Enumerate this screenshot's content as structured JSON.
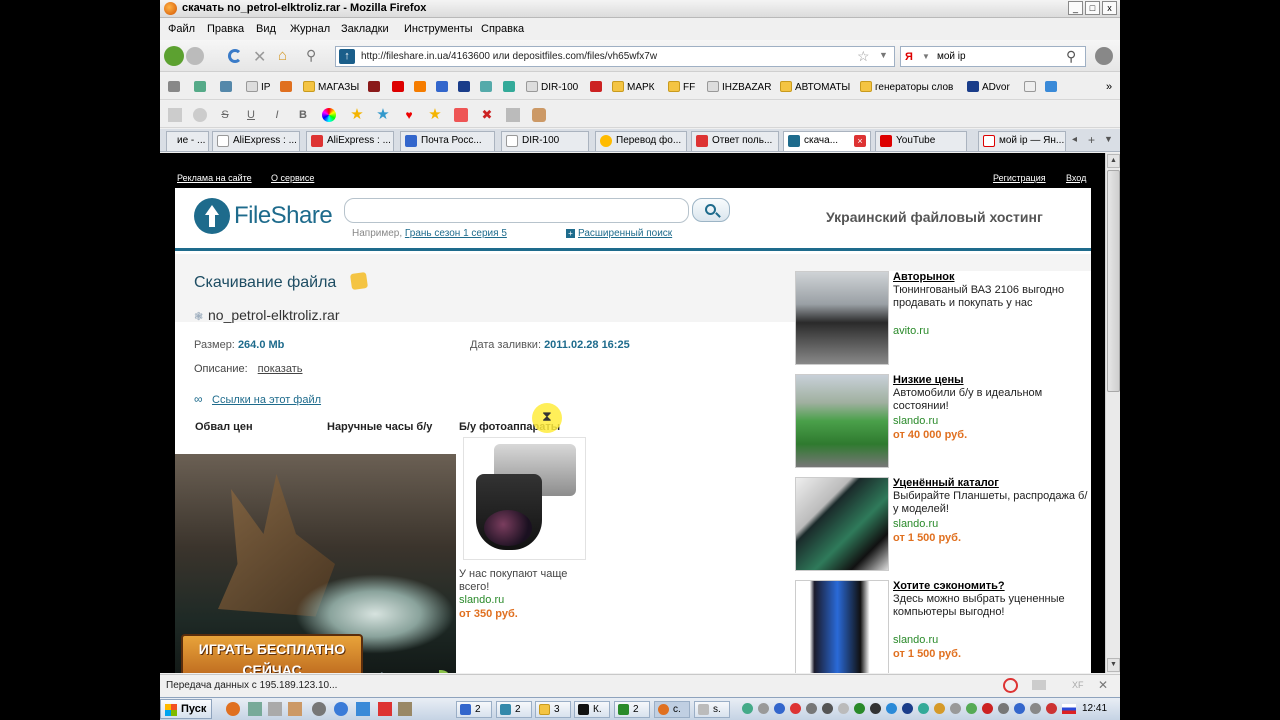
{
  "window": {
    "title": "скачать no_petrol-elktroliz.rar - Mozilla Firefox",
    "minimize": "_",
    "maximize": "□",
    "close": "x"
  },
  "menu": [
    "Файл",
    "Правка",
    "Вид",
    "Журнал",
    "Закладки",
    "Инструменты",
    "Справка"
  ],
  "nav": {
    "url": "http://fileshare.in.ua/4163600 или depositfiles.com/files/vh65wfx7w",
    "search_value": "мой ip",
    "search_engine": "Я"
  },
  "bookmarks": [
    "IP",
    "МАГАЗЫ",
    "DIR-100",
    "МАРК",
    "FF",
    "IHZBAZAR",
    "АВТОМАТЫ",
    "генераторы слов",
    "ADvor"
  ],
  "tabs": [
    "ие - ...",
    "AliExpress : ...",
    "AliExpress : ...",
    "Почта Росс...",
    "DIR-100",
    "Перевод фо...",
    "Ответ поль...",
    "скача...",
    "YouTube",
    "мой ip — Ян..."
  ],
  "site": {
    "top_links": {
      "ads": "Реклама на сайте",
      "about": "О сервисе",
      "register": "Регистрация",
      "login": "Вход"
    },
    "logo": "FileShare",
    "search_hint_prefix": "Например,",
    "search_hint_example": "Грань сезон 1 серия 5",
    "advanced_search": "Расширенный поиск",
    "tagline": "Украинский файловый хостинг"
  },
  "file": {
    "heading": "Скачивание файла",
    "name": "no_petrol-elktroliz.rar",
    "size_label": "Размер:",
    "size_value": "264.0 Mb",
    "date_label": "Дата заливки:",
    "date_value": "2011.02.28 16:25",
    "desc_label": "Описание:",
    "desc_link": "показать",
    "links_label": "Ссылки на этот файл"
  },
  "categories": [
    "Обвал цен",
    "Наручные часы б/у",
    "Б/у фотоаппараты"
  ],
  "video": {
    "banner_line1": "ИГРАТЬ БЕСПЛАТНО",
    "banner_line2": "СЕЙЧАС"
  },
  "camera_ad": {
    "text": "У нас покупают чаще всего!",
    "site": "slando.ru",
    "price": "от 350 руб."
  },
  "ads": [
    {
      "title": "Авторынок",
      "desc": "Тюнингованый ВАЗ 2106 выгодно продавать и покупать у нас",
      "site": "avito.ru",
      "price": ""
    },
    {
      "title": "Низкие цены",
      "desc": "Автомобили б/у в идеальном состоянии!",
      "site": "slando.ru",
      "price": "от 40 000 руб."
    },
    {
      "title": "Уценённый каталог",
      "desc": "Выбирайте Планшеты, распродажа б/у моделей!",
      "site": "slando.ru",
      "price": "от 1 500 руб."
    },
    {
      "title": "Хотите сэкономить?",
      "desc": "Здесь можно выбрать уцененные компьютеры выгодно!",
      "site": "slando.ru",
      "price": "от 1 500 руб."
    }
  ],
  "status": "Передача данных с 195.189.123.10...",
  "taskbar": {
    "start": "Пуск",
    "items": [
      "2",
      "2",
      "3",
      "К.",
      "2",
      "с.",
      "s."
    ],
    "clock": "12:41"
  },
  "colors": {
    "brand": "#1e6b8c",
    "price": "#e07020",
    "site_link": "#2a8a2a"
  }
}
